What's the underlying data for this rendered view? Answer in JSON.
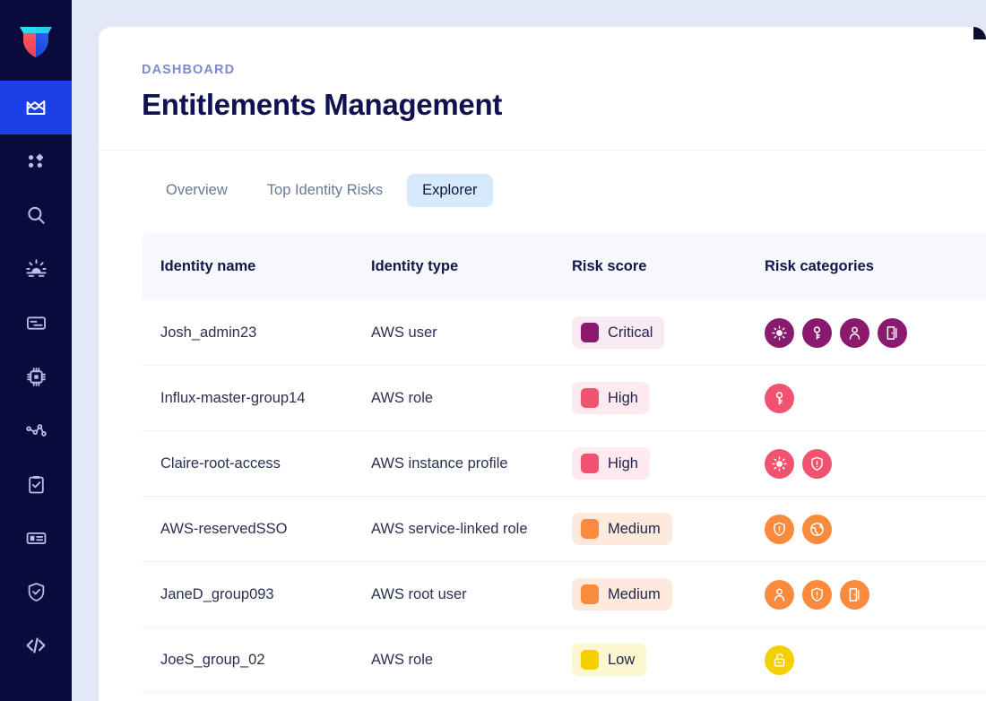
{
  "sidebar": {
    "logo_name": "company-shield-logo",
    "active_index": 0,
    "items": [
      {
        "icon": "chart-trend-icon",
        "label": "Dashboard"
      },
      {
        "icon": "grid-dots-icon",
        "label": "Inventory"
      },
      {
        "icon": "search-icon",
        "label": "Search"
      },
      {
        "icon": "sunrise-alert-icon",
        "label": "Alerts"
      },
      {
        "icon": "id-card-icon",
        "label": "Identities"
      },
      {
        "icon": "cpu-chip-icon",
        "label": "Compute"
      },
      {
        "icon": "network-graph-icon",
        "label": "Topology"
      },
      {
        "icon": "clipboard-check-icon",
        "label": "Compliance"
      },
      {
        "icon": "badge-card-icon",
        "label": "Reports"
      },
      {
        "icon": "shield-check-icon",
        "label": "Security"
      },
      {
        "icon": "code-brackets-icon",
        "label": "Developers"
      }
    ]
  },
  "header": {
    "eyebrow": "DASHBOARD",
    "title": "Entitlements Management"
  },
  "tabs": [
    {
      "label": "Overview",
      "active": false
    },
    {
      "label": "Top Identity Risks",
      "active": false
    },
    {
      "label": "Explorer",
      "active": true
    }
  ],
  "table": {
    "columns": [
      "Identity name",
      "Identity type",
      "Risk score",
      "Risk categories"
    ],
    "rows": [
      {
        "identity_name": "Josh_admin23",
        "identity_type": "AWS user",
        "risk_score": "Critical",
        "risk_level": "critical",
        "categories": [
          "sun-check-icon",
          "key-icon",
          "person-icon",
          "door-icon"
        ]
      },
      {
        "identity_name": "Influx-master-group14",
        "identity_type": "AWS role",
        "risk_score": "High",
        "risk_level": "high",
        "categories": [
          "key-icon"
        ]
      },
      {
        "identity_name": "Claire-root-access",
        "identity_type": "AWS instance profile",
        "risk_score": "High",
        "risk_level": "high",
        "categories": [
          "sun-check-icon",
          "shield-alert-icon"
        ]
      },
      {
        "identity_name": "AWS-reservedSSO",
        "identity_type": "AWS service-linked role",
        "risk_score": "Medium",
        "risk_level": "medium",
        "categories": [
          "shield-alert-icon",
          "globe-icon"
        ]
      },
      {
        "identity_name": "JaneD_group093",
        "identity_type": "AWS root user",
        "risk_score": "Medium",
        "risk_level": "medium",
        "categories": [
          "person-icon",
          "shield-alert-icon",
          "door-icon"
        ]
      },
      {
        "identity_name": "JoeS_group_02",
        "identity_type": "AWS role",
        "risk_score": "Low",
        "risk_level": "low",
        "categories": [
          "unlock-icon"
        ]
      }
    ]
  },
  "colors": {
    "sidebar_bg": "#0a0b3d",
    "sidebar_active": "#1d3fe8",
    "page_bg": "#e3e8f7",
    "accent_tab": "#d7eafb",
    "eyebrow": "#7d8ccc",
    "title": "#0f1150",
    "critical": "#8a1a6e",
    "critical_bg": "#f8e9f3",
    "high": "#ef5370",
    "high_bg": "#fde9ee",
    "medium": "#fb8b3c",
    "medium_bg": "#fdeadd",
    "low": "#f5d000",
    "low_bg": "#fcf7cf"
  }
}
